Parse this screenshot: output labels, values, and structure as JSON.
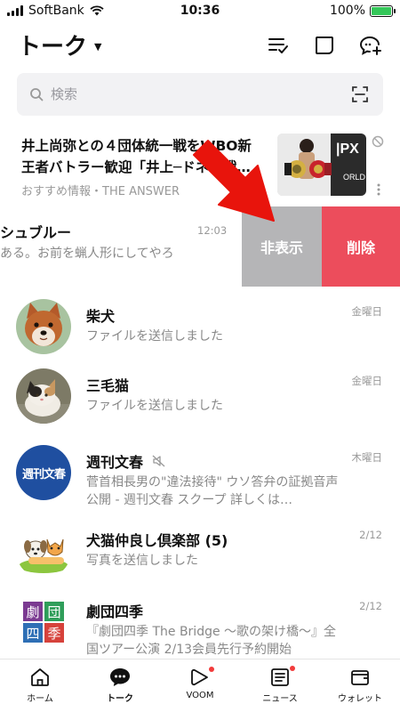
{
  "status": {
    "carrier": "SoftBank",
    "time": "10:36",
    "battery": "100%",
    "battery_level": 1.0
  },
  "header": {
    "title": "トーク"
  },
  "search": {
    "placeholder": "検索"
  },
  "news": {
    "headline": "井上尚弥との４団体統一戦をWBO新王者バトラー歓迎「井上─ドネア戦…",
    "source": "おすすめ情報・THE ANSWER"
  },
  "swiped_chat": {
    "name": "シュブルー",
    "message": "ある。お前を蝋人形にしてやろ",
    "time": "12:03",
    "hide_label": "非表示",
    "delete_label": "削除"
  },
  "chats": [
    {
      "name": "柴犬",
      "message": "ファイルを送信しました",
      "time": "金曜日",
      "avatar": "shiba-dog"
    },
    {
      "name": "三毛猫",
      "message": "ファイルを送信しました",
      "time": "金曜日",
      "avatar": "calico-cat"
    },
    {
      "name": "週刊文春",
      "message": "菅首相長男の\"違法接待\" ウソ答弁の証拠音声公開 - 週刊文春 スクープ  詳しくは…",
      "time": "木曜日",
      "avatar": "bunshun-logo",
      "muted": true,
      "avatar_text": "週刊文春"
    },
    {
      "name": "犬猫仲良し倶楽部 (5)",
      "message": "写真を送信しました",
      "time": "2/12",
      "avatar": "dog-cat-illustration"
    },
    {
      "name": "劇団四季",
      "message": "『劇団四季 The Bridge ～歌の架け橋～』全国ツアー公演 2/13会員先行予約開始",
      "time": "2/12",
      "avatar": "shiki-logo",
      "avatar_chars": [
        "劇",
        "団",
        "四",
        "季"
      ]
    }
  ],
  "tabs": [
    {
      "label": "ホーム",
      "icon": "home-icon",
      "badge": false
    },
    {
      "label": "トーク",
      "icon": "talk-icon",
      "badge": false
    },
    {
      "label": "VOOM",
      "icon": "voom-icon",
      "badge": true
    },
    {
      "label": "ニュース",
      "icon": "news-icon",
      "badge": true
    },
    {
      "label": "ウォレット",
      "icon": "wallet-icon",
      "badge": false
    }
  ],
  "colors": {
    "delete_red": "#ec4d5c",
    "hide_gray": "#b5b5b7",
    "arrow_red": "#e8140c",
    "battery_green": "#34c759",
    "badge_red": "#f23b3b"
  }
}
